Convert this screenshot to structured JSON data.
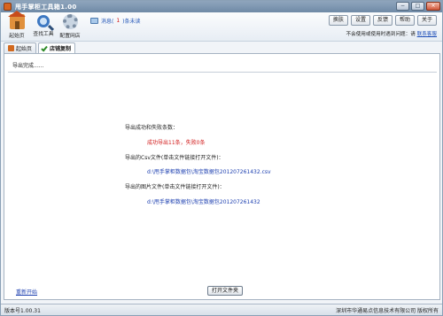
{
  "window": {
    "title": "甩手掌柜工具箱1.00",
    "controls": {
      "minimize": "−",
      "maximize": "□",
      "close": "×"
    }
  },
  "toolbar": {
    "tools": [
      {
        "label": "起始页",
        "icon": "home-icon"
      },
      {
        "label": "查找工具",
        "icon": "search-icon"
      },
      {
        "label": "配置网店",
        "icon": "gear-icon"
      }
    ],
    "message": {
      "prefix": "消息(",
      "count": "1",
      "suffix": ")条未读"
    },
    "buttons": [
      "换肤",
      "设置",
      "反馈",
      "帮助",
      "关于"
    ],
    "help_text": "不会使用或使用时遇到问题：请",
    "help_link": "联系客服"
  },
  "tabs": [
    {
      "label": "起始页",
      "icon": "home-icon",
      "active": false
    },
    {
      "label": "店铺复制",
      "icon": "check-icon",
      "active": true
    }
  ],
  "content": {
    "status": "导出完成......",
    "result_heading": "导出成功和失败条数：",
    "result_counts": "成功导出11条，失败0条",
    "csv_heading": "导出的Csv文件(单击文件链接打开文件)：",
    "csv_link": "d:\\甩手掌柜数据包\\淘宝数据包201207261432.csv",
    "image_heading": "导出的图片文件(单击文件链接打开文件)：",
    "image_link": "d:\\甩手掌柜数据包\\淘宝数据包201207261432",
    "restart_link": "重新开始",
    "open_folder_button": "打开文件夹"
  },
  "statusbar": {
    "version": "版本号1.00.31",
    "copyright": "深圳市华通易点信息技术有限公司 版权所有"
  },
  "colors": {
    "link": "#1c3fb0",
    "error_red": "#d11a1a",
    "title_bar": "#7f97b1"
  }
}
